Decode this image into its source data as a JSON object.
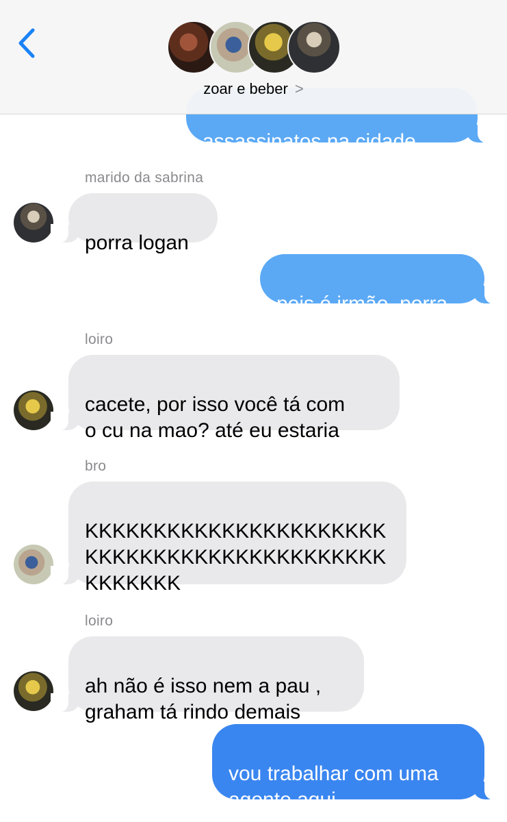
{
  "header": {
    "title": "zoar e beber",
    "back_icon": "chevron-left-icon",
    "title_chevron": ">",
    "accent_color": "#1a82f7"
  },
  "messages": [
    {
      "direction": "out",
      "text": "assassinatos na cidade"
    },
    {
      "direction": "in",
      "sender": "marido da sabrina",
      "text": "porra logan"
    },
    {
      "direction": "out",
      "text": "pois é irmão, porra"
    },
    {
      "direction": "in",
      "sender": "loiro",
      "text": "cacete, por isso você tá com\no cu na mao? até eu estaria"
    },
    {
      "direction": "in",
      "sender": "bro",
      "text": "KKKKKKKKKKKKKKKKKKKKKK\nKKKKKKKKKKKKKKKKKKKKKK\nKKKKKKK"
    },
    {
      "direction": "in",
      "sender": "loiro",
      "text": "ah não é isso nem a pau ,\ngraham tá rindo demais"
    },
    {
      "direction": "out",
      "text": "vou trabalhar com uma\nagente aqui"
    }
  ],
  "colors": {
    "incoming_bubble": "#e9e9eb",
    "outgoing_bubble": "#5ba9f5",
    "outgoing_bubble_latest": "#3a86f0",
    "sender_name": "#8a8a8e"
  }
}
